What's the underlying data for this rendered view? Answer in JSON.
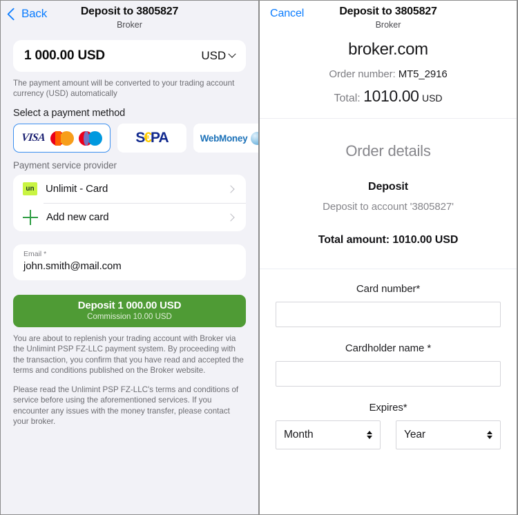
{
  "left": {
    "header": {
      "back_label": "Back",
      "title": "Deposit to 3805827",
      "subtitle": "Broker"
    },
    "amount": {
      "value": "1 000.00 USD",
      "currency": "USD"
    },
    "hint": "The payment amount will be converted to your trading account currency (USD) automatically",
    "method_section_label": "Select a payment method",
    "methods": [
      {
        "id": "cards",
        "label": "VISA",
        "selected": true
      },
      {
        "id": "sepa",
        "label": "SEPA",
        "selected": false
      },
      {
        "id": "webmoney",
        "label": "WebMoney",
        "selected": false
      }
    ],
    "provider_section_label": "Payment service provider",
    "providers": [
      {
        "label": "Unlimit - Card",
        "icon": "unlimit-logo",
        "icon_text": "un"
      },
      {
        "label": "Add new card",
        "icon": "plus-icon"
      }
    ],
    "email": {
      "label": "Email *",
      "value": "john.smith@mail.com"
    },
    "deposit_button": {
      "main": "Deposit 1 000.00 USD",
      "sub": "Commission 10.00 USD",
      "color": "#4f9b35"
    },
    "legal_1": "You are about to replenish your trading account with Broker via the Unlimint PSP FZ-LLC payment system. By proceeding with the transaction, you confirm that you have read and accepted the terms and conditions published on the Broker website.",
    "legal_2": "Please read the Unlimint PSP FZ-LLC's terms and conditions of service before using the aforementioned services. If you encounter any issues with the money transfer, please contact your broker."
  },
  "right": {
    "header": {
      "cancel_label": "Cancel",
      "title": "Deposit to 3805827",
      "subtitle": "Broker"
    },
    "merchant": "broker.com",
    "order_label": "Order number:",
    "order_number": "MT5_2916",
    "total_label": "Total:",
    "total_amount": "1010.00",
    "total_currency": "USD",
    "order_details": {
      "title": "Order details",
      "kind": "Deposit",
      "description": "Deposit to account '3805827'",
      "total_line": "Total amount: 1010.00 USD"
    },
    "form": {
      "card_number_label": "Card number*",
      "card_number_value": "",
      "cardholder_label": "Cardholder name *",
      "cardholder_value": "",
      "expires_label": "Expires*",
      "month_value": "Month",
      "year_value": "Year"
    }
  }
}
